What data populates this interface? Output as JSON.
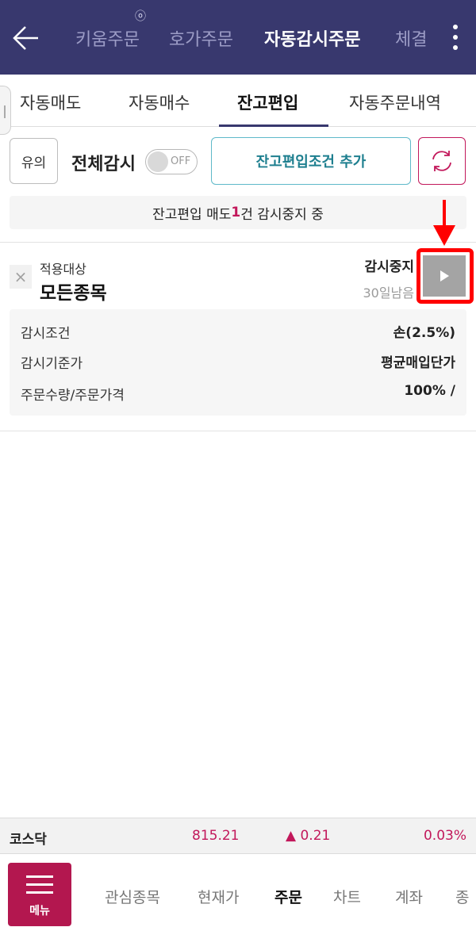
{
  "header": {
    "tabs": [
      {
        "label": "키움주문",
        "active": false
      },
      {
        "label": "호가주문",
        "active": false
      },
      {
        "label": "자동감시주문",
        "active": true
      },
      {
        "label": "체결",
        "active": false
      }
    ]
  },
  "subtabs": [
    {
      "label": "자동매도",
      "active": false
    },
    {
      "label": "자동매수",
      "active": false
    },
    {
      "label": "잔고편입",
      "active": true
    },
    {
      "label": "자동주문내역",
      "active": false
    }
  ],
  "controls": {
    "caution_label": "유의",
    "all_monitor_label": "전체감시",
    "toggle_state": "OFF",
    "add_condition_label": "잔고편입조건 추가"
  },
  "notice": {
    "prefix": "잔고편입 매도 ",
    "count": "1",
    "suffix": "건 감시중지 중"
  },
  "item": {
    "target_label": "적용대상",
    "target_value": "모든종목",
    "status": "감시중지",
    "days_left": "30일남음",
    "details": [
      {
        "key": "감시조건",
        "value": "손(2.5%)"
      },
      {
        "key": "감시기준가",
        "value": "평균매입단가"
      },
      {
        "key": "주문수량/주문가격",
        "value": "100% /"
      }
    ]
  },
  "index_bar": {
    "name": "코스닥",
    "price": "815.21",
    "change": "▲ 0.21",
    "rate": "0.03%"
  },
  "bottom_nav": {
    "menu_label": "메뉴",
    "items": [
      {
        "label": "관심종목",
        "active": false
      },
      {
        "label": "현재가",
        "active": false
      },
      {
        "label": "주문",
        "active": true
      },
      {
        "label": "차트",
        "active": false
      },
      {
        "label": "계좌",
        "active": false
      },
      {
        "label": "종",
        "active": false
      }
    ]
  },
  "colors": {
    "header_bg": "#38386e",
    "accent": "#c2185b",
    "teal": "#1e7f8f",
    "highlight": "#ff0000"
  }
}
